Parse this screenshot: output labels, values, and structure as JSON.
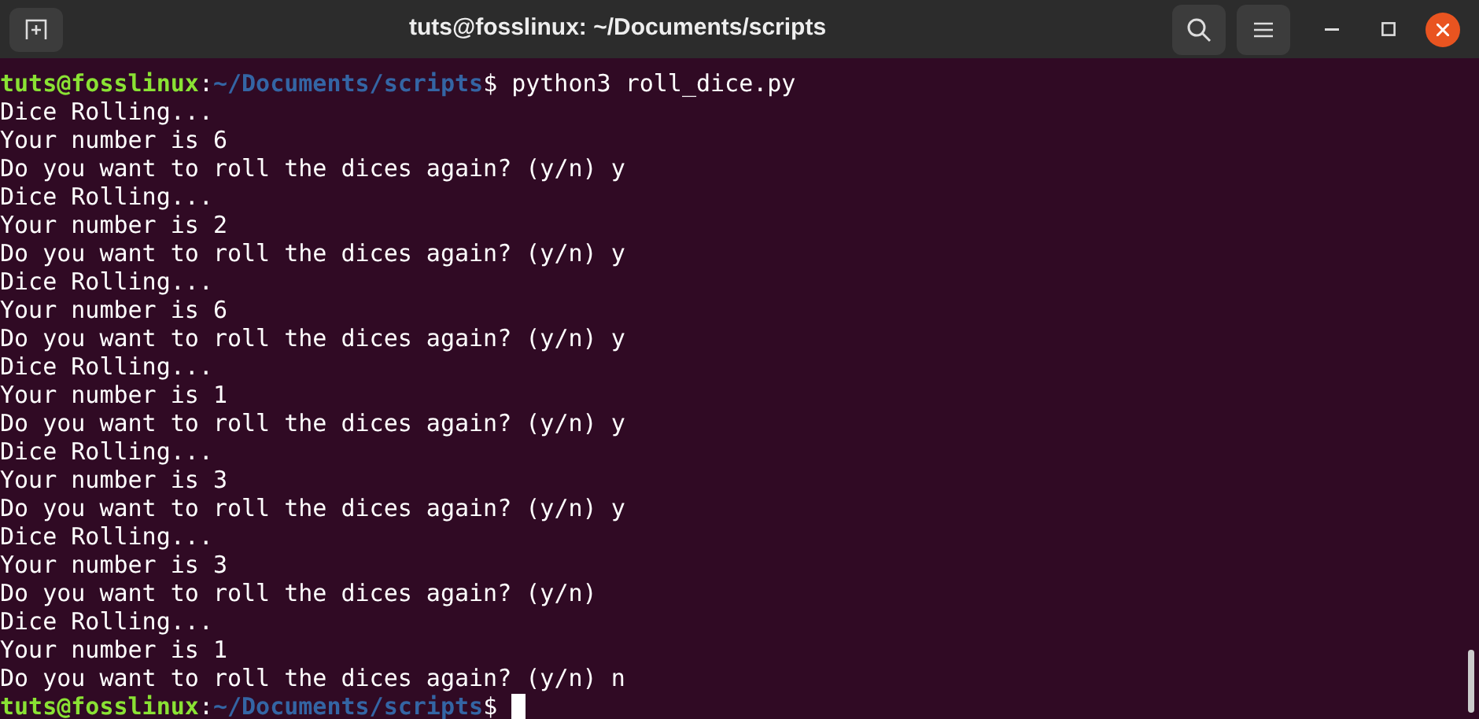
{
  "window": {
    "title": "tuts@fosslinux: ~/Documents/scripts"
  },
  "lines": [
    {
      "kind": "prompt",
      "user": "tuts@fosslinux",
      "separator": ":",
      "path": "~/Documents/scripts",
      "symbol": "$",
      "command": "python3 roll_dice.py",
      "cursor": false
    },
    {
      "kind": "output",
      "text": "Dice Rolling..."
    },
    {
      "kind": "output",
      "text": "Your number is 6"
    },
    {
      "kind": "output",
      "text": "Do you want to roll the dices again? (y/n) y"
    },
    {
      "kind": "output",
      "text": "Dice Rolling..."
    },
    {
      "kind": "output",
      "text": "Your number is 2"
    },
    {
      "kind": "output",
      "text": "Do you want to roll the dices again? (y/n) y"
    },
    {
      "kind": "output",
      "text": "Dice Rolling..."
    },
    {
      "kind": "output",
      "text": "Your number is 6"
    },
    {
      "kind": "output",
      "text": "Do you want to roll the dices again? (y/n) y"
    },
    {
      "kind": "output",
      "text": "Dice Rolling..."
    },
    {
      "kind": "output",
      "text": "Your number is 1"
    },
    {
      "kind": "output",
      "text": "Do you want to roll the dices again? (y/n) y"
    },
    {
      "kind": "output",
      "text": "Dice Rolling..."
    },
    {
      "kind": "output",
      "text": "Your number is 3"
    },
    {
      "kind": "output",
      "text": "Do you want to roll the dices again? (y/n) y"
    },
    {
      "kind": "output",
      "text": "Dice Rolling..."
    },
    {
      "kind": "output",
      "text": "Your number is 3"
    },
    {
      "kind": "output",
      "text": "Do you want to roll the dices again? (y/n)"
    },
    {
      "kind": "output",
      "text": "Dice Rolling..."
    },
    {
      "kind": "output",
      "text": "Your number is 1"
    },
    {
      "kind": "output",
      "text": "Do you want to roll the dices again? (y/n) n"
    },
    {
      "kind": "prompt",
      "user": "tuts@fosslinux",
      "separator": ":",
      "path": "~/Documents/scripts",
      "symbol": "$",
      "cursor": true
    }
  ]
}
